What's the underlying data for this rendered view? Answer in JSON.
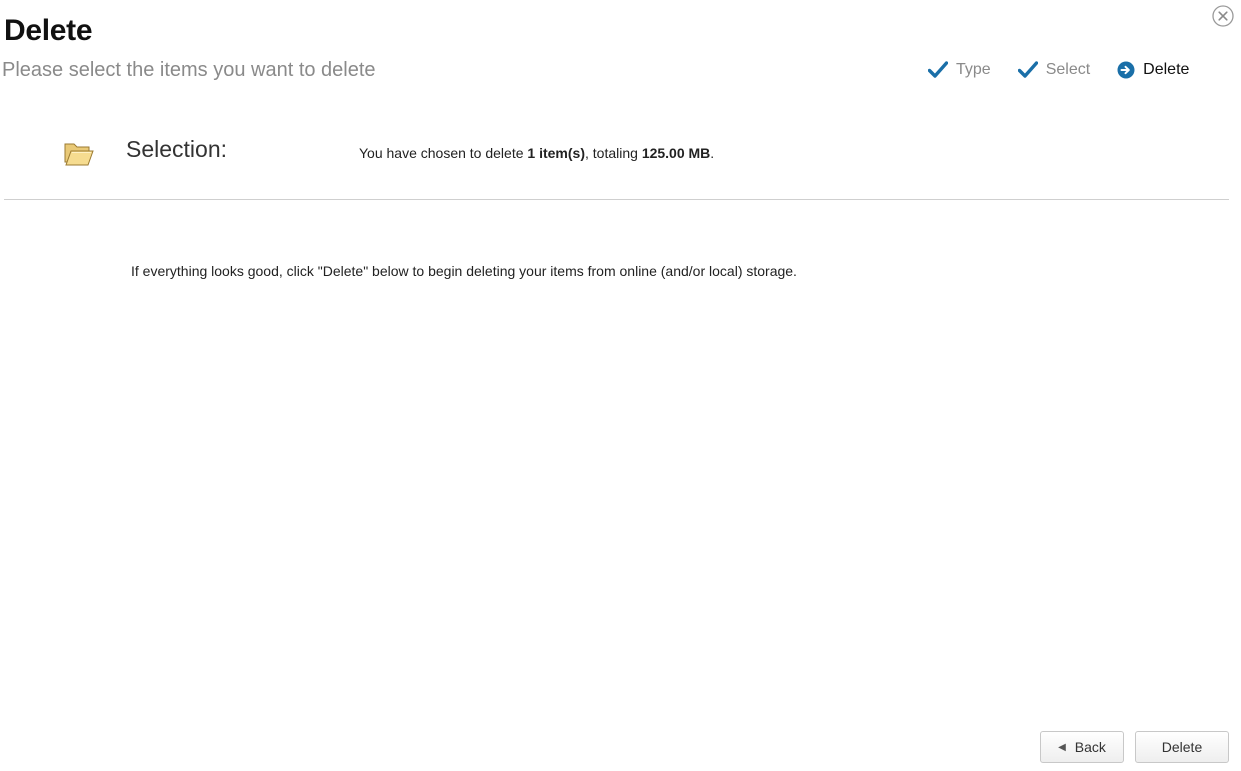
{
  "dialog": {
    "title": "Delete",
    "subtitle": "Please select the items you want to delete",
    "close_icon": "close-circle-icon"
  },
  "steps": [
    {
      "label": "Type",
      "state": "done",
      "icon": "checkmark-icon"
    },
    {
      "label": "Select",
      "state": "done",
      "icon": "checkmark-icon"
    },
    {
      "label": "Delete",
      "state": "current",
      "icon": "arrow-right-circle-icon"
    }
  ],
  "selection": {
    "icon": "open-folder-icon",
    "label": "Selection:",
    "summary_prefix": "You have chosen to delete ",
    "item_count": "1 item(s)",
    "summary_middle": ", totaling ",
    "total_size": "125.00 MB",
    "summary_suffix": "."
  },
  "instructions": "If everything looks good, click \"Delete\" below to begin deleting your items from online (and/or local) storage.",
  "buttons": {
    "back_label": "Back",
    "back_icon": "triangle-left-icon",
    "delete_label": "Delete"
  },
  "colors": {
    "accent": "#1a6fa8",
    "muted_text": "#8a8a8a",
    "divider": "#cfcfcf"
  }
}
